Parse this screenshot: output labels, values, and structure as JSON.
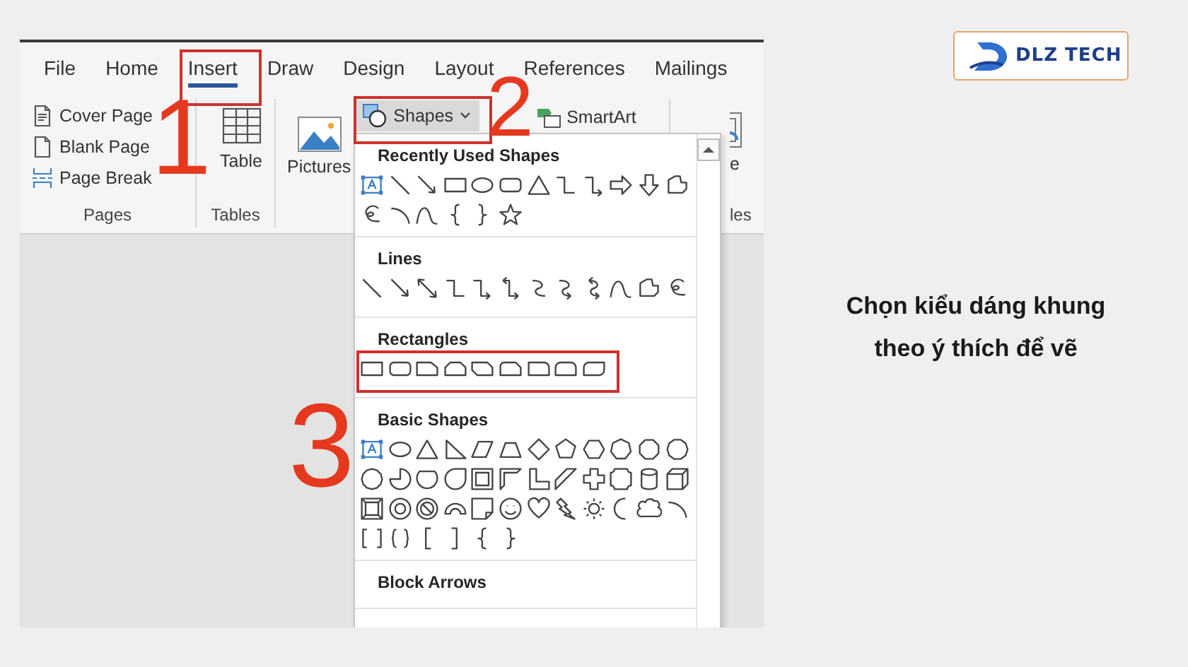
{
  "ribbon_tabs": [
    {
      "label": "File",
      "selected": false
    },
    {
      "label": "Home",
      "selected": false
    },
    {
      "label": "Insert",
      "selected": true
    },
    {
      "label": "Draw",
      "selected": false
    },
    {
      "label": "Design",
      "selected": false
    },
    {
      "label": "Layout",
      "selected": false
    },
    {
      "label": "References",
      "selected": false
    },
    {
      "label": "Mailings",
      "selected": false
    }
  ],
  "pages_group": {
    "label": "Pages",
    "commands": [
      "Cover Page",
      "Blank Page",
      "Page Break"
    ]
  },
  "tables_group": {
    "label": "Tables",
    "command": "Table"
  },
  "illustrations": {
    "pictures": "Pictures",
    "shapes": {
      "label": "Shapes",
      "expanded": true
    },
    "smartart": "SmartArt"
  },
  "clipped_group": {
    "command_fragment": "e",
    "label_fragment": "les"
  },
  "shapes_gallery": {
    "sections": [
      {
        "kind": "recent",
        "title": "Recently Used Shapes"
      },
      {
        "kind": "lines",
        "title": "Lines"
      },
      {
        "kind": "rectangles",
        "title": "Rectangles"
      },
      {
        "kind": "basic",
        "title": "Basic Shapes"
      },
      {
        "kind": "block_arrows",
        "title": "Block Arrows"
      }
    ]
  },
  "annotations": [
    {
      "number": "1"
    },
    {
      "number": "2"
    },
    {
      "number": "3"
    }
  ],
  "logo": {
    "name": "DLZ TECH"
  },
  "caption": [
    "Chọn kiểu dáng khung",
    "theo ý thích để vẽ"
  ]
}
